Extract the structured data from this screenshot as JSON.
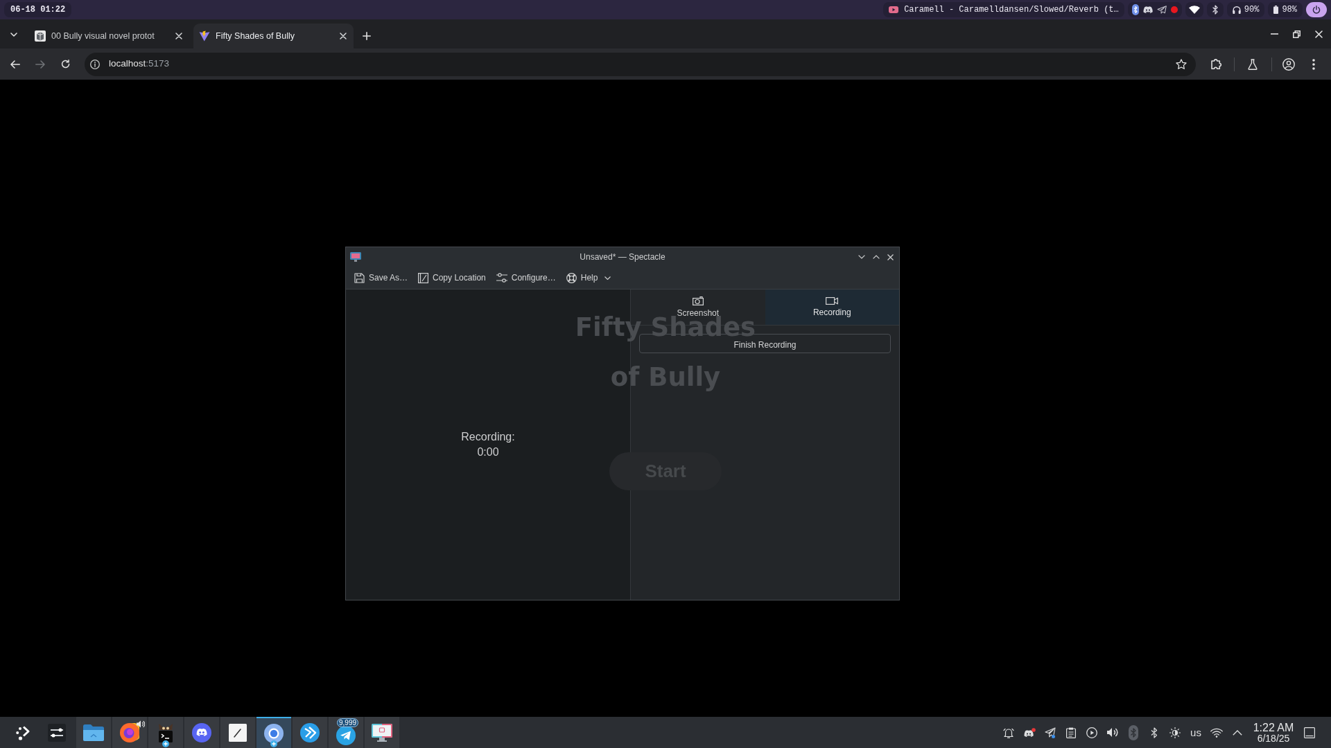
{
  "top_bar": {
    "clock": "06-18 01:22",
    "media_title": "Caramell - Caramelldansen/Slowed/Reverb (t…",
    "recording": true,
    "headset_battery": "90%",
    "battery": "98%"
  },
  "browser": {
    "tabs": [
      {
        "title": "00 Bully visual novel protot",
        "selected": false
      },
      {
        "title": "Fifty Shades of Bully",
        "selected": true
      }
    ],
    "forward_disabled": true,
    "address": {
      "host": "localhost",
      "port": ":5173"
    }
  },
  "page": {
    "title_lines": [
      "Fifty Shades",
      "of Bully"
    ],
    "start_button": "Start"
  },
  "spectacle": {
    "title": "Unsaved* — Spectacle",
    "toolbar": [
      {
        "label": "Save As…",
        "dropdown": false
      },
      {
        "label": "Copy Location",
        "dropdown": false
      },
      {
        "label": "Configure…",
        "dropdown": false
      },
      {
        "label": "Help",
        "dropdown": true
      }
    ],
    "modes": [
      {
        "label": "Screenshot",
        "selected": false
      },
      {
        "label": "Recording",
        "selected": true
      }
    ],
    "finish_button": "Finish Recording",
    "status_lines": [
      "Recording:",
      "0:00"
    ]
  },
  "taskbar": {
    "tasks": [
      {
        "selected": false,
        "audio": false,
        "extra_windows": false
      },
      {
        "selected": false,
        "audio": true,
        "extra_windows": false
      },
      {
        "selected": false,
        "audio": false,
        "extra_windows": true
      },
      {
        "selected": false,
        "audio": false,
        "extra_windows": false
      },
      {
        "selected": false,
        "audio": false,
        "extra_windows": false
      },
      {
        "selected": true,
        "audio": false,
        "extra_windows": true
      },
      {
        "selected": false,
        "audio": false,
        "extra_windows": false
      },
      {
        "selected": false,
        "audio": false,
        "extra_windows": false,
        "badge": "9,999"
      },
      {
        "selected": false,
        "audio": false,
        "extra_windows": false
      }
    ],
    "keyboard_layout": "us",
    "clock": {
      "time": "1:22 AM",
      "date": "6/18/25"
    }
  }
}
